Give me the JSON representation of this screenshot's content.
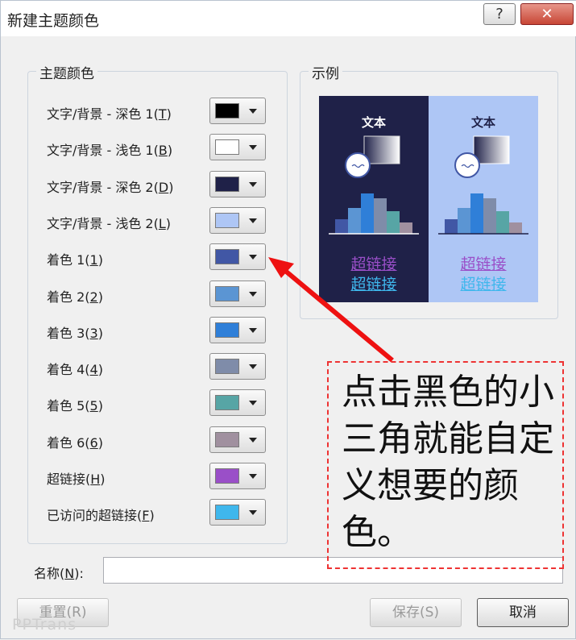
{
  "window": {
    "title": "新建主题颜色",
    "help_icon": "?",
    "close_icon": "✕"
  },
  "theme_colors": {
    "legend": "主题颜色",
    "rows": [
      {
        "label": "文字/背景 - 深色 1(",
        "key": "T",
        "end": ")",
        "color": "#000000"
      },
      {
        "label": "文字/背景 - 浅色 1(",
        "key": "B",
        "end": ")",
        "color": "#ffffff"
      },
      {
        "label": "文字/背景 - 深色 2(",
        "key": "D",
        "end": ")",
        "color": "#1f2148"
      },
      {
        "label": "文字/背景 - 浅色 2(",
        "key": "L",
        "end": ")",
        "color": "#aec6f5"
      },
      {
        "label": "着色 1(",
        "key": "1",
        "end": ")",
        "color": "#4157a5"
      },
      {
        "label": "着色 2(",
        "key": "2",
        "end": ")",
        "color": "#5b95d3"
      },
      {
        "label": "着色 3(",
        "key": "3",
        "end": ")",
        "color": "#2f7fd8"
      },
      {
        "label": "着色 4(",
        "key": "4",
        "end": ")",
        "color": "#7f8ca9"
      },
      {
        "label": "着色 5(",
        "key": "5",
        "end": ")",
        "color": "#57a5a5"
      },
      {
        "label": "着色 6(",
        "key": "6",
        "end": ")",
        "color": "#a0909f"
      },
      {
        "label": "超链接(",
        "key": "H",
        "end": ")",
        "color": "#9a4fc8"
      },
      {
        "label": "已访问的超链接(",
        "key": "F",
        "end": ")",
        "color": "#3fb7ec"
      }
    ]
  },
  "sample": {
    "legend": "示例",
    "text_label": "文本",
    "link_label": "超链接",
    "visited_link_label": "超链接",
    "link_color": "#9a4fc8",
    "visited_color": "#3fb7ec"
  },
  "name_field": {
    "label": "名称(",
    "key": "N",
    "end": "):",
    "value": ""
  },
  "buttons": {
    "reset": "重置(R)",
    "save": "保存(S)",
    "cancel": "取消"
  },
  "annotation": {
    "text": "点击黑色的小三角就能自定义想要的颜色。"
  },
  "watermark": "PPTrans"
}
